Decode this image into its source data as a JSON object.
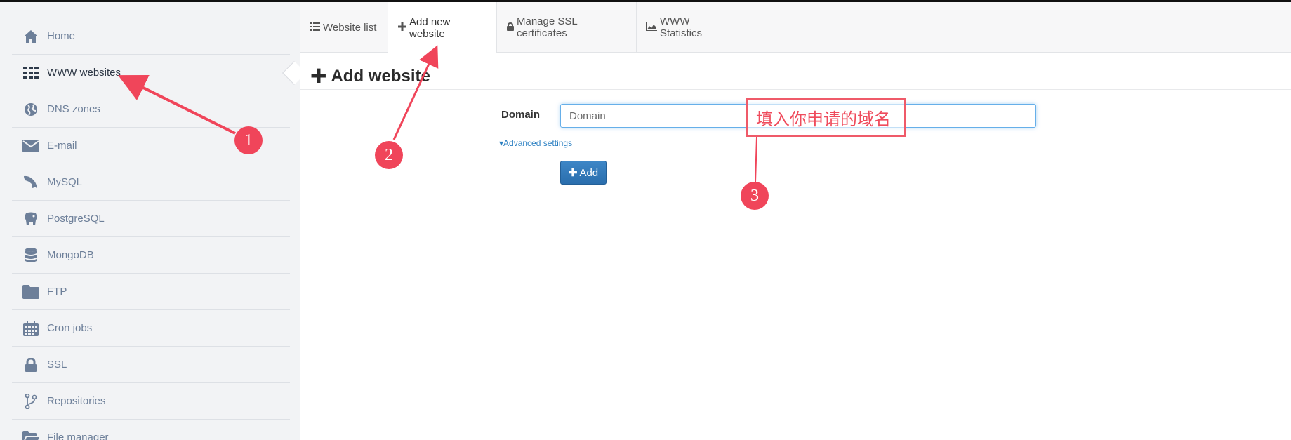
{
  "sidebar": {
    "items": [
      {
        "label": "Home",
        "icon": "home-icon"
      },
      {
        "label": "WWW websites",
        "icon": "grid-icon",
        "active": true
      },
      {
        "label": "DNS zones",
        "icon": "globe-icon"
      },
      {
        "label": "E-mail",
        "icon": "envelope-icon"
      },
      {
        "label": "MySQL",
        "icon": "dolphin-icon"
      },
      {
        "label": "PostgreSQL",
        "icon": "elephant-icon"
      },
      {
        "label": "MongoDB",
        "icon": "database-icon"
      },
      {
        "label": "FTP",
        "icon": "folder-icon"
      },
      {
        "label": "Cron jobs",
        "icon": "calendar-icon"
      },
      {
        "label": "SSL",
        "icon": "lock-icon"
      },
      {
        "label": "Repositories",
        "icon": "branch-icon"
      },
      {
        "label": "File manager",
        "icon": "folder-open-icon"
      }
    ]
  },
  "tabs": [
    {
      "label": "Website list",
      "icon": "list-icon"
    },
    {
      "label": "Add new website",
      "icon": "plus-icon",
      "active": true
    },
    {
      "label": "Manage SSL certificates",
      "icon": "lock-icon"
    },
    {
      "label": "WWW Statistics",
      "icon": "area-chart-icon"
    }
  ],
  "main": {
    "title": "Add website",
    "form": {
      "domain_label": "Domain",
      "domain_placeholder": "Domain",
      "domain_value": "",
      "advanced_label": "Advanced settings",
      "add_label": "Add"
    }
  },
  "annotations": {
    "markers": [
      "1",
      "2",
      "3"
    ],
    "callout_text": "填入你申请的域名",
    "color": "#f0455a"
  },
  "colors": {
    "sidebar_bg": "#f2f3f5",
    "icon_muted": "#6d7f99",
    "accent_blue": "#2a6ead",
    "link_blue": "#2a7fc2"
  }
}
